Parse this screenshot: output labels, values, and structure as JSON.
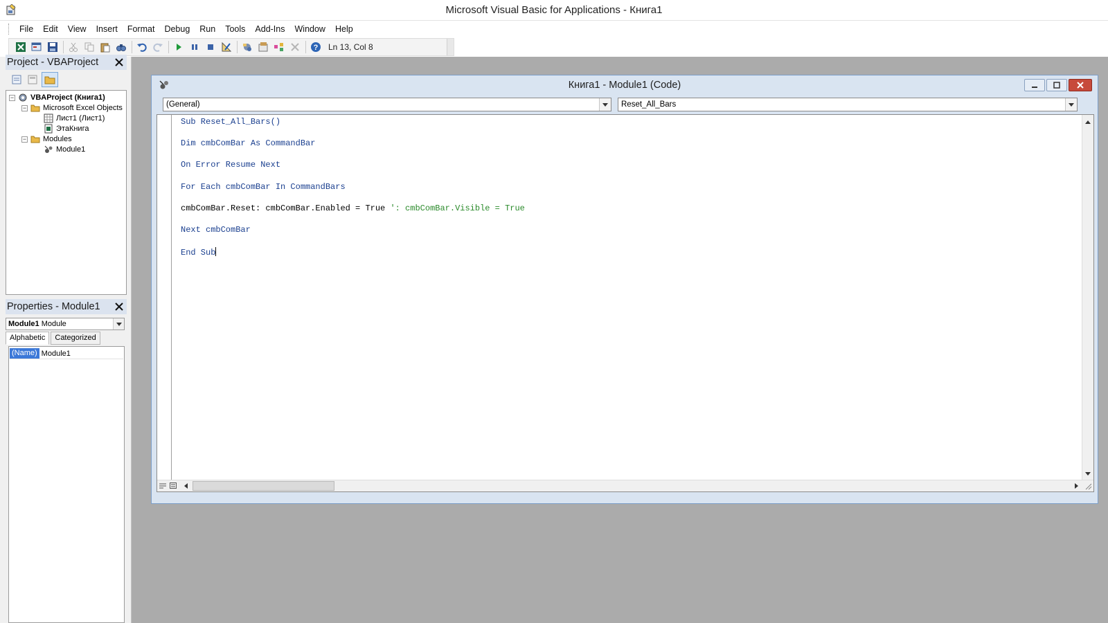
{
  "app": {
    "title": "Microsoft Visual Basic for Applications - Книга1"
  },
  "menu": [
    "File",
    "Edit",
    "View",
    "Insert",
    "Format",
    "Debug",
    "Run",
    "Tools",
    "Add-Ins",
    "Window",
    "Help"
  ],
  "toolbar": {
    "status": "Ln 13, Col 8",
    "icons": [
      "excel-icon",
      "insert-userform-icon",
      "save-icon",
      "cut-icon",
      "copy-icon",
      "paste-icon",
      "find-icon",
      "undo-icon",
      "redo-icon",
      "run-icon",
      "break-icon",
      "reset-icon",
      "design-mode-icon",
      "project-explorer-icon",
      "properties-window-icon",
      "object-browser-icon",
      "toolbox-icon",
      "help-icon"
    ]
  },
  "project_panel": {
    "title": "Project - VBAProject",
    "tree": [
      {
        "label": "VBAProject (Книга1)",
        "level": 0
      },
      {
        "label": "Microsoft Excel Objects",
        "level": 1
      },
      {
        "label": "Лист1 (Лист1)",
        "level": 2
      },
      {
        "label": "ЭтаКнига",
        "level": 2
      },
      {
        "label": "Modules",
        "level": 1
      },
      {
        "label": "Module1",
        "level": 2
      }
    ]
  },
  "properties_panel": {
    "title": "Properties - Module1",
    "object_name": "Module1",
    "object_type": "Module",
    "tabs": [
      "Alphabetic",
      "Categorized"
    ],
    "rows": [
      {
        "name": "(Name)",
        "value": "Module1"
      }
    ]
  },
  "code_window": {
    "title": "Книга1 - Module1 (Code)",
    "object_combo": "(General)",
    "procedure_combo": "Reset_All_Bars",
    "lines": [
      [
        "Sub Reset_All_Bars()"
      ],
      [
        "Dim cmbComBar As CommandBar"
      ],
      [
        "On Error Resume Next"
      ],
      [
        "For Each cmbComBar In CommandBars"
      ],
      [
        "cmbComBar.Reset: cmbComBar.Enabled = True ",
        "': cmbComBar.Visible = True"
      ],
      [
        "Next cmbComBar"
      ],
      [
        "End Sub"
      ]
    ]
  },
  "colors": {
    "keyword": "#1a3f8f",
    "comment": "#2a8a2a",
    "panel_header": "#dbe3ef",
    "window_frame": "#d9e4f1"
  }
}
